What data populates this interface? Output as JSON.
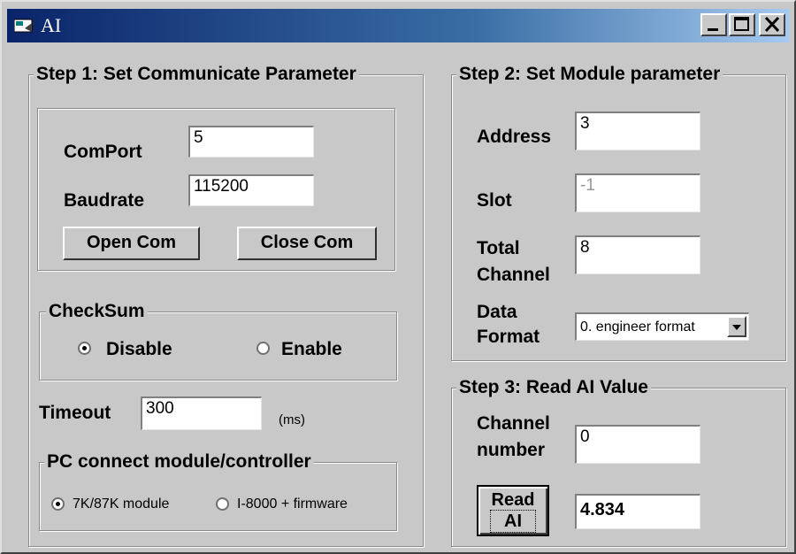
{
  "window": {
    "title": "AI"
  },
  "step1": {
    "legend": "Step 1: Set Communicate Parameter",
    "comport_label": "ComPort",
    "comport_value": "5",
    "baudrate_label": "Baudrate",
    "baudrate_value": "115200",
    "open_label": "Open Com",
    "close_label": "Close Com"
  },
  "checksum": {
    "legend": "CheckSum",
    "options": [
      {
        "label": "Disable",
        "selected": true
      },
      {
        "label": "Enable",
        "selected": false
      }
    ]
  },
  "timeout": {
    "label": "Timeout",
    "value": "300",
    "unit": "(ms)"
  },
  "pc_connect": {
    "legend": "PC connect module/controller",
    "options": [
      {
        "label": "7K/87K module",
        "selected": true
      },
      {
        "label": "I-8000 + firmware",
        "selected": false
      }
    ]
  },
  "step2": {
    "legend": "Step 2: Set Module parameter",
    "address_label": "Address",
    "address_value": "3",
    "slot_label": "Slot",
    "slot_value": "-1",
    "total_channel_label_1": "Total",
    "total_channel_label_2": "Channel",
    "total_channel_value": "8",
    "data_format_label_1": "Data",
    "data_format_label_2": "Format",
    "data_format_value": "0. engineer format"
  },
  "step3": {
    "legend": "Step 3: Read AI Value",
    "channel_label_1": "Channel",
    "channel_label_2": "number",
    "channel_value": "0",
    "read_label_1": "Read",
    "read_label_2": "AI",
    "result_value": "4.834"
  }
}
